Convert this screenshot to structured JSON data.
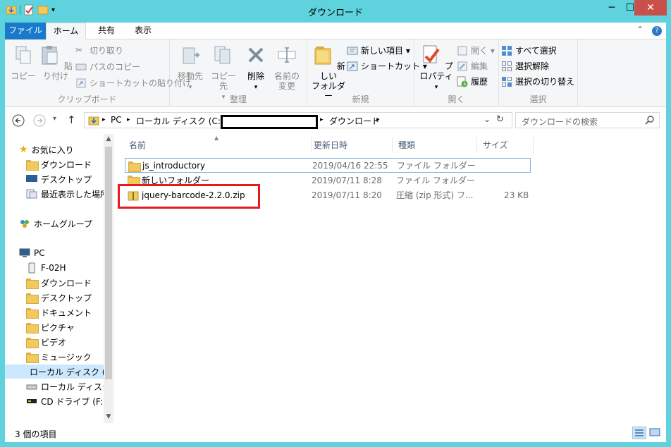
{
  "window": {
    "title": "ダウンロード"
  },
  "tabs": {
    "file": "ファイル",
    "home": "ホーム",
    "share": "共有",
    "view": "表示"
  },
  "ribbon": {
    "clipboard": {
      "label": "クリップボード",
      "copy": "コピー",
      "paste": "貼り付け",
      "cut": "切り取り",
      "copy_path": "パスのコピー",
      "paste_shortcut": "ショートカットの貼り付け"
    },
    "organize": {
      "label": "整理",
      "move_to": "移動先",
      "copy_to": "コピー先",
      "delete": "削除",
      "rename_1": "名前の",
      "rename_2": "変更"
    },
    "new": {
      "label": "新規",
      "new_folder_1": "新しい",
      "new_folder_2": "フォルダー",
      "new_item": "新しい項目 ▾",
      "easy_access": "ショートカット ▾"
    },
    "open": {
      "label": "開く",
      "properties": "プロパティ",
      "open": "開く ▾",
      "edit": "編集",
      "history": "履歴"
    },
    "select": {
      "label": "選択",
      "select_all": "すべて選択",
      "select_none": "選択解除",
      "invert": "選択の切り替え"
    }
  },
  "address": {
    "crumbs": [
      "PC",
      "ローカル ディスク (C:)",
      "ダウンロード"
    ],
    "search_placeholder": "ダウンロードの検索"
  },
  "nav": {
    "favorites": "お気に入り",
    "fav_items": [
      "ダウンロード",
      "デスクトップ",
      "最近表示した場所"
    ],
    "homegroup": "ホームグループ",
    "pc": "PC",
    "pc_items": [
      "F-02H",
      "ダウンロード",
      "デスクトップ",
      "ドキュメント",
      "ピクチャ",
      "ビデオ",
      "ミュージック",
      "ローカル ディスク (C:)",
      "ローカル ディスク (D:)",
      "CD ドライブ (F:)"
    ]
  },
  "columns": {
    "name": "名前",
    "date": "更新日時",
    "type": "種類",
    "size": "サイズ"
  },
  "files": [
    {
      "name": "js_introductory",
      "date": "2019/04/16 22:55",
      "type": "ファイル フォルダー",
      "size": ""
    },
    {
      "name": "新しいフォルダー",
      "date": "2019/07/11 8:28",
      "type": "ファイル フォルダー",
      "size": ""
    },
    {
      "name": "jquery-barcode-2.2.0.zip",
      "date": "2019/07/11 8:20",
      "type": "圧縮 (zip 形式) フ...",
      "size": "23 KB"
    }
  ],
  "status": {
    "item_count": "3 個の項目"
  },
  "colors": {
    "titlebar": "#5fd3dd",
    "file_tab": "#1979ca",
    "highlight": "#e81a1e",
    "close": "#c7504a"
  }
}
